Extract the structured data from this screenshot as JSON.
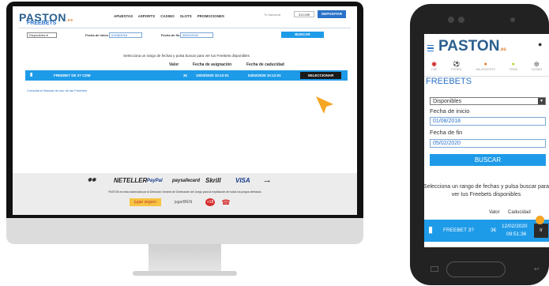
{
  "brand": {
    "name": "PASTON",
    "suffix": ".es"
  },
  "desktop": {
    "nav": [
      "APUESTAS",
      "eSPORTS",
      "CASINO",
      "SLOTS",
      "PROMOCIONES"
    ],
    "login_text": "Tu bancaria",
    "balance": "313,00€",
    "deposit_label": "DEPOSITAR",
    "page_title": "FREEBETS",
    "filter_select": "Disponibles",
    "start_label": "Fecha de inicio",
    "start_value": "01/08/2018",
    "end_label": "Fecha de fin",
    "end_value": "05/02/2020",
    "search_label": "BUSCAR",
    "hint": "Selecciona un rango de fechas y pulsa buscar para ver tus Freebets disponibles",
    "table": {
      "headers": [
        "Valor",
        "Fecha de asignación",
        "Fecha de caducidad"
      ],
      "row": {
        "name": "FREEBET DE 3? CDM",
        "value": "3€",
        "assigned": "10/03/2020 10:12:01",
        "expires": "04/02/2020 10:12:01",
        "action": "SELECCIONAR"
      }
    },
    "manual_link": "Consulta el Manual de uso de las Freebets",
    "payments": [
      "NETELLER",
      "PayPal",
      "paysafecard",
      "Skrill",
      "VISA"
    ],
    "legal": "PASTON.es está autorizada por la Dirección General de Ordenación del Juego para la explotación de todos los juegos ofertados",
    "badges": [
      "jugar seguro",
      "jugarBIEN",
      "+18"
    ]
  },
  "mobile": {
    "categories": [
      {
        "icon": "live-icon",
        "label": "LIVE"
      },
      {
        "icon": "soccer-icon",
        "label": "FÚTBOL"
      },
      {
        "icon": "basketball-icon",
        "label": "BALONCESTO"
      },
      {
        "icon": "tennis-icon",
        "label": "TENIS"
      },
      {
        "icon": "casino-icon",
        "label": "CASINO"
      }
    ],
    "page_title": "FREEBETS",
    "filter_select": "Disponibles",
    "start_label": "Fecha de inicio",
    "start_value": "01/08/2018",
    "end_label": "Fecha de fin",
    "end_value": "05/02/2020",
    "search_label": "BUSCAR",
    "hint_line1": "Selecciona un rango de fechas y pulsa buscar para",
    "hint_line2": "ver tus Freebets disponibles",
    "headers": [
      "Valor",
      "Caducidad"
    ],
    "row": {
      "name": "FREEBET 3?",
      "value": "3€",
      "date": "12/02/2020",
      "time": "09:51:36",
      "action": "Ir"
    }
  },
  "colors": {
    "accent": "#1e9be8",
    "brand": "#2b5f8f",
    "cursor": "#f5a623"
  }
}
